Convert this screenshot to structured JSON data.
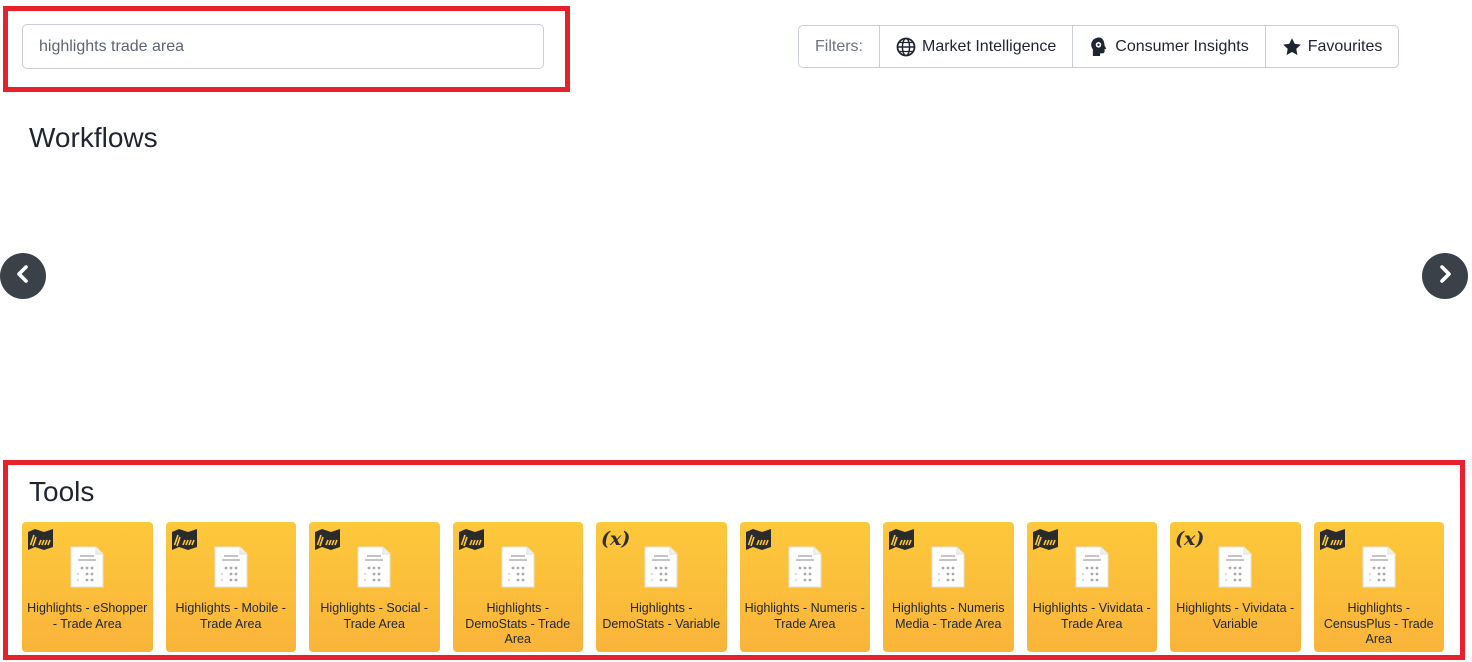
{
  "search": {
    "value": "highlights trade area",
    "placeholder": ""
  },
  "filters": {
    "label": "Filters:",
    "items": [
      {
        "label": "Market Intelligence",
        "icon": "globe-icon"
      },
      {
        "label": "Consumer Insights",
        "icon": "head-gear-icon"
      },
      {
        "label": "Favourites",
        "icon": "star-icon"
      }
    ]
  },
  "sections": {
    "workflows": "Workflows",
    "tools": "Tools"
  },
  "carousel": {
    "prev_icon": "chevron-left-icon",
    "next_icon": "chevron-right-icon"
  },
  "tools": [
    {
      "label": "Highlights - eShopper - Trade Area",
      "badge": "map-icon"
    },
    {
      "label": "Highlights - Mobile - Trade Area",
      "badge": "map-icon"
    },
    {
      "label": "Highlights - Social - Trade Area",
      "badge": "map-icon"
    },
    {
      "label": "Highlights - DemoStats - Trade Area",
      "badge": "map-icon"
    },
    {
      "label": "Highlights - DemoStats - Variable",
      "badge": "variable-icon"
    },
    {
      "label": "Highlights - Numeris - Trade Area",
      "badge": "map-icon"
    },
    {
      "label": "Highlights - Numeris Media - Trade Area",
      "badge": "map-icon"
    },
    {
      "label": "Highlights - Vividata - Trade Area",
      "badge": "map-icon"
    },
    {
      "label": "Highlights - Vividata - Variable",
      "badge": "variable-icon"
    },
    {
      "label": "Highlights - CensusPlus - Trade Area",
      "badge": "map-icon"
    }
  ],
  "colors": {
    "card": "#fdc83b",
    "highlight": "#e8202a",
    "arrow": "#3b4149"
  }
}
